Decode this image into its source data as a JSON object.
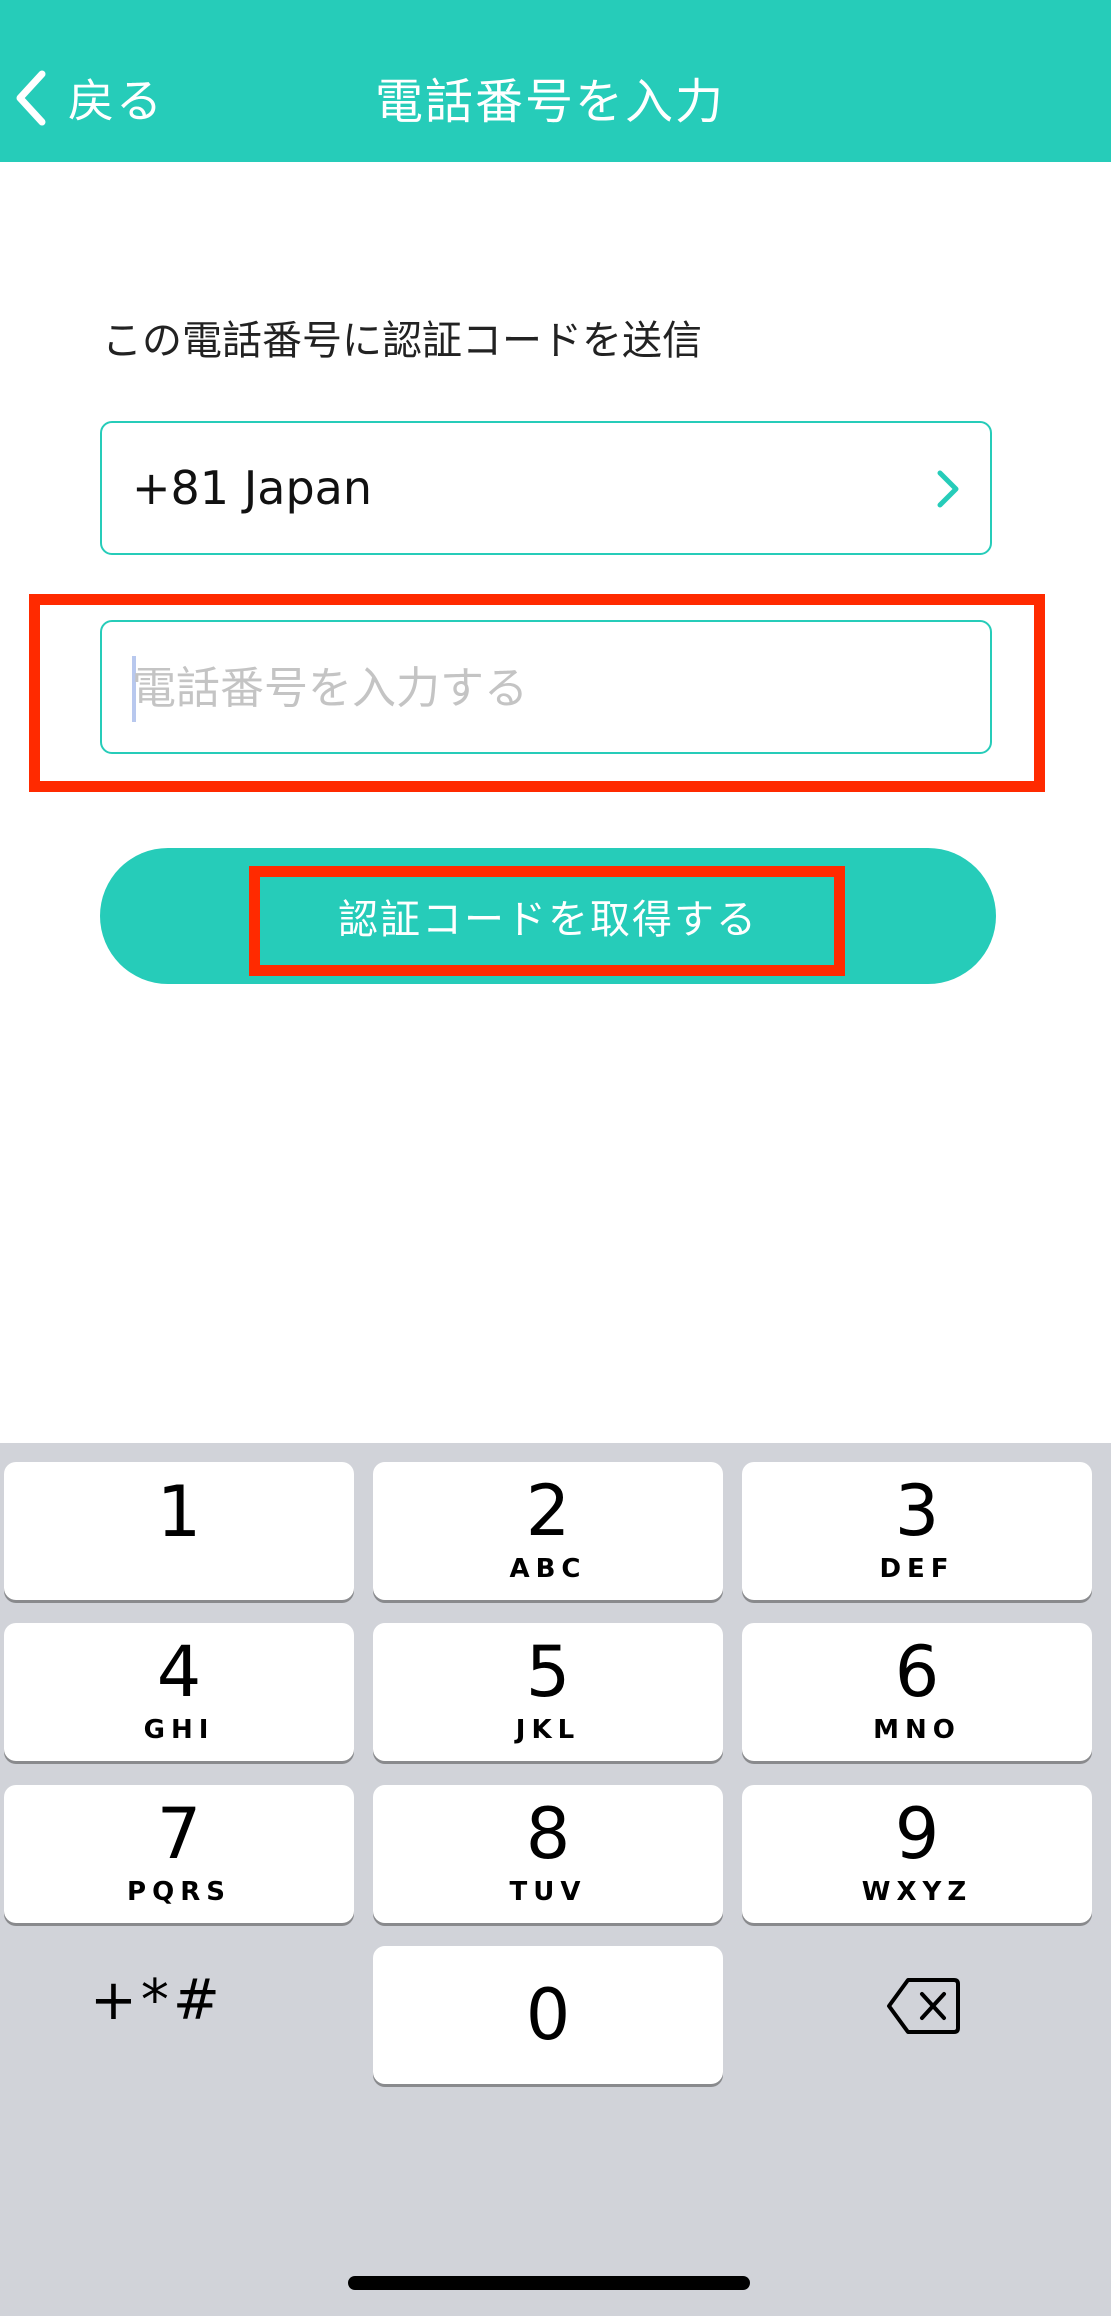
{
  "header": {
    "back_label": "戻る",
    "title": "電話番号を入力"
  },
  "instruction": "この電話番号に認証コードを送信",
  "country_select": {
    "label": "+81 Japan"
  },
  "phone_input": {
    "value": "",
    "placeholder": "電話番号を入力する"
  },
  "submit_button": {
    "label": "認証コードを取得する"
  },
  "keypad": {
    "keys": [
      {
        "digit": "1",
        "letters": ""
      },
      {
        "digit": "2",
        "letters": "ABC"
      },
      {
        "digit": "3",
        "letters": "DEF"
      },
      {
        "digit": "4",
        "letters": "GHI"
      },
      {
        "digit": "5",
        "letters": "JKL"
      },
      {
        "digit": "6",
        "letters": "MNO"
      },
      {
        "digit": "7",
        "letters": "PQRS"
      },
      {
        "digit": "8",
        "letters": "TUV"
      },
      {
        "digit": "9",
        "letters": "WXYZ"
      },
      {
        "digit": "0",
        "letters": ""
      }
    ],
    "symbols_label": "+*#"
  },
  "colors": {
    "accent": "#26CCB9",
    "highlight": "#FF2A00",
    "keyboard_bg": "#D1D3D9"
  },
  "icons": {
    "back": "chevron-left-icon",
    "country": "chevron-right-icon",
    "delete": "backspace-icon"
  }
}
